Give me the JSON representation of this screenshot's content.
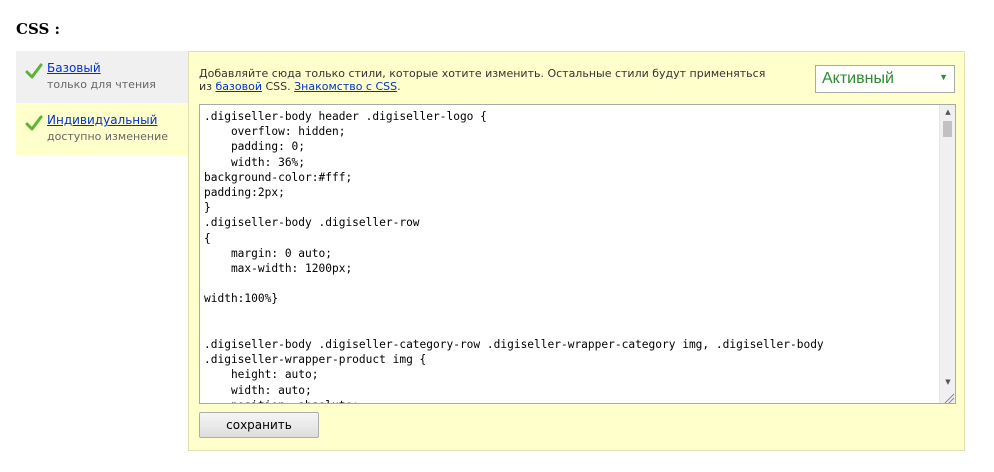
{
  "page": {
    "title": "CSS :"
  },
  "tabs": [
    {
      "label": "Базовый",
      "sublabel": "только для чтения",
      "selected": false
    },
    {
      "label": "Индивидуальный",
      "sublabel": "доступно изменение",
      "selected": true
    }
  ],
  "hint": {
    "text_before": "Добавляйте сюда только стили, которые хотите изменить. Остальные стили будут применяться из ",
    "link_basic": "базовой",
    "text_middle": " CSS. ",
    "link_intro": "Знакомство с CSS",
    "text_after": "."
  },
  "status_select": {
    "value": "Активный"
  },
  "editor": {
    "content": ".digiseller-body header .digiseller-logo {\n    overflow: hidden;\n    padding: 0;\n    width: 36%;\nbackground-color:#fff;\npadding:2px;\n}\n.digiseller-body .digiseller-row\n{\n    margin: 0 auto;\n    max-width: 1200px;\n\nwidth:100%}\n\n\n.digiseller-body .digiseller-category-row .digiseller-wrapper-category img, .digiseller-body\n.digiseller-wrapper-product img {\n    height: auto;\n    width: auto;\n    position: absolute;"
  },
  "save_button": {
    "label": "сохранить"
  },
  "colors": {
    "panel_bg": "#ffffcc",
    "link": "#0033cc",
    "status_green": "#2e8b2e",
    "check_green": "#5cb531"
  },
  "icons": {
    "tab_check": "checkmark-icon"
  }
}
